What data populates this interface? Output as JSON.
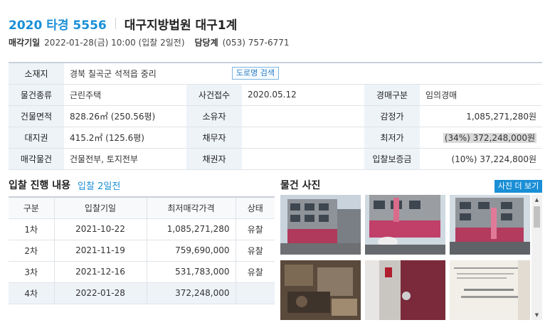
{
  "header": {
    "case_no": "2020 타경 5556",
    "court": "대구지방법원 대구1계"
  },
  "subline": {
    "sale_date_label": "매각기일",
    "sale_date_value": "2022-01-28(금) 10:00 (입찰 2일전)",
    "dept_label": "담당계",
    "dept_value": "(053) 757-6771"
  },
  "info": {
    "address_label": "소재지",
    "address_value": "경북 칠곡군 석적읍 중리",
    "road_btn": "도로명 검색",
    "type_label": "물건종류",
    "type_value": "근린주택",
    "received_label": "사건접수",
    "received_value": "2020.05.12",
    "kind_label": "경매구분",
    "kind_value": "임의경매",
    "building_area_label": "건물면적",
    "building_area_value": "828.26㎡ (250.56평)",
    "owner_label": "소유자",
    "owner_value": "",
    "appraisal_label": "감정가",
    "appraisal_value": "1,085,271,280원",
    "land_label": "대지권",
    "land_value": "415.2㎡ (125.6평)",
    "debtor_label": "채무자",
    "debtor_value": "",
    "min_price_label": "최저가",
    "min_price_value": "(34%) 372,248,000원",
    "sale_item_label": "매각물건",
    "sale_item_value": "건물전부, 토지전부",
    "creditor_label": "채권자",
    "creditor_value": "",
    "deposit_label": "입찰보증금",
    "deposit_value": "(10%) 37,224,800원"
  },
  "bids": {
    "title": "입찰 진행 내용",
    "subtitle": "입찰 2일전",
    "headers": [
      "구분",
      "입찰기일",
      "최저매각가격",
      "상태"
    ],
    "rows": [
      {
        "round": "1차",
        "date": "2021-10-22",
        "price": "1,085,271,280",
        "status": "유찰"
      },
      {
        "round": "2차",
        "date": "2021-11-19",
        "price": "759,690,000",
        "status": "유찰"
      },
      {
        "round": "3차",
        "date": "2021-12-16",
        "price": "531,783,000",
        "status": "유찰"
      },
      {
        "round": "4차",
        "date": "2022-01-28",
        "price": "372,248,000",
        "status": ""
      }
    ]
  },
  "photos": {
    "title": "물건 사진",
    "more_btn": "사진 더 보기"
  },
  "colors": {
    "accent": "#1a8fd6",
    "header_cell": "#eef3f8"
  }
}
